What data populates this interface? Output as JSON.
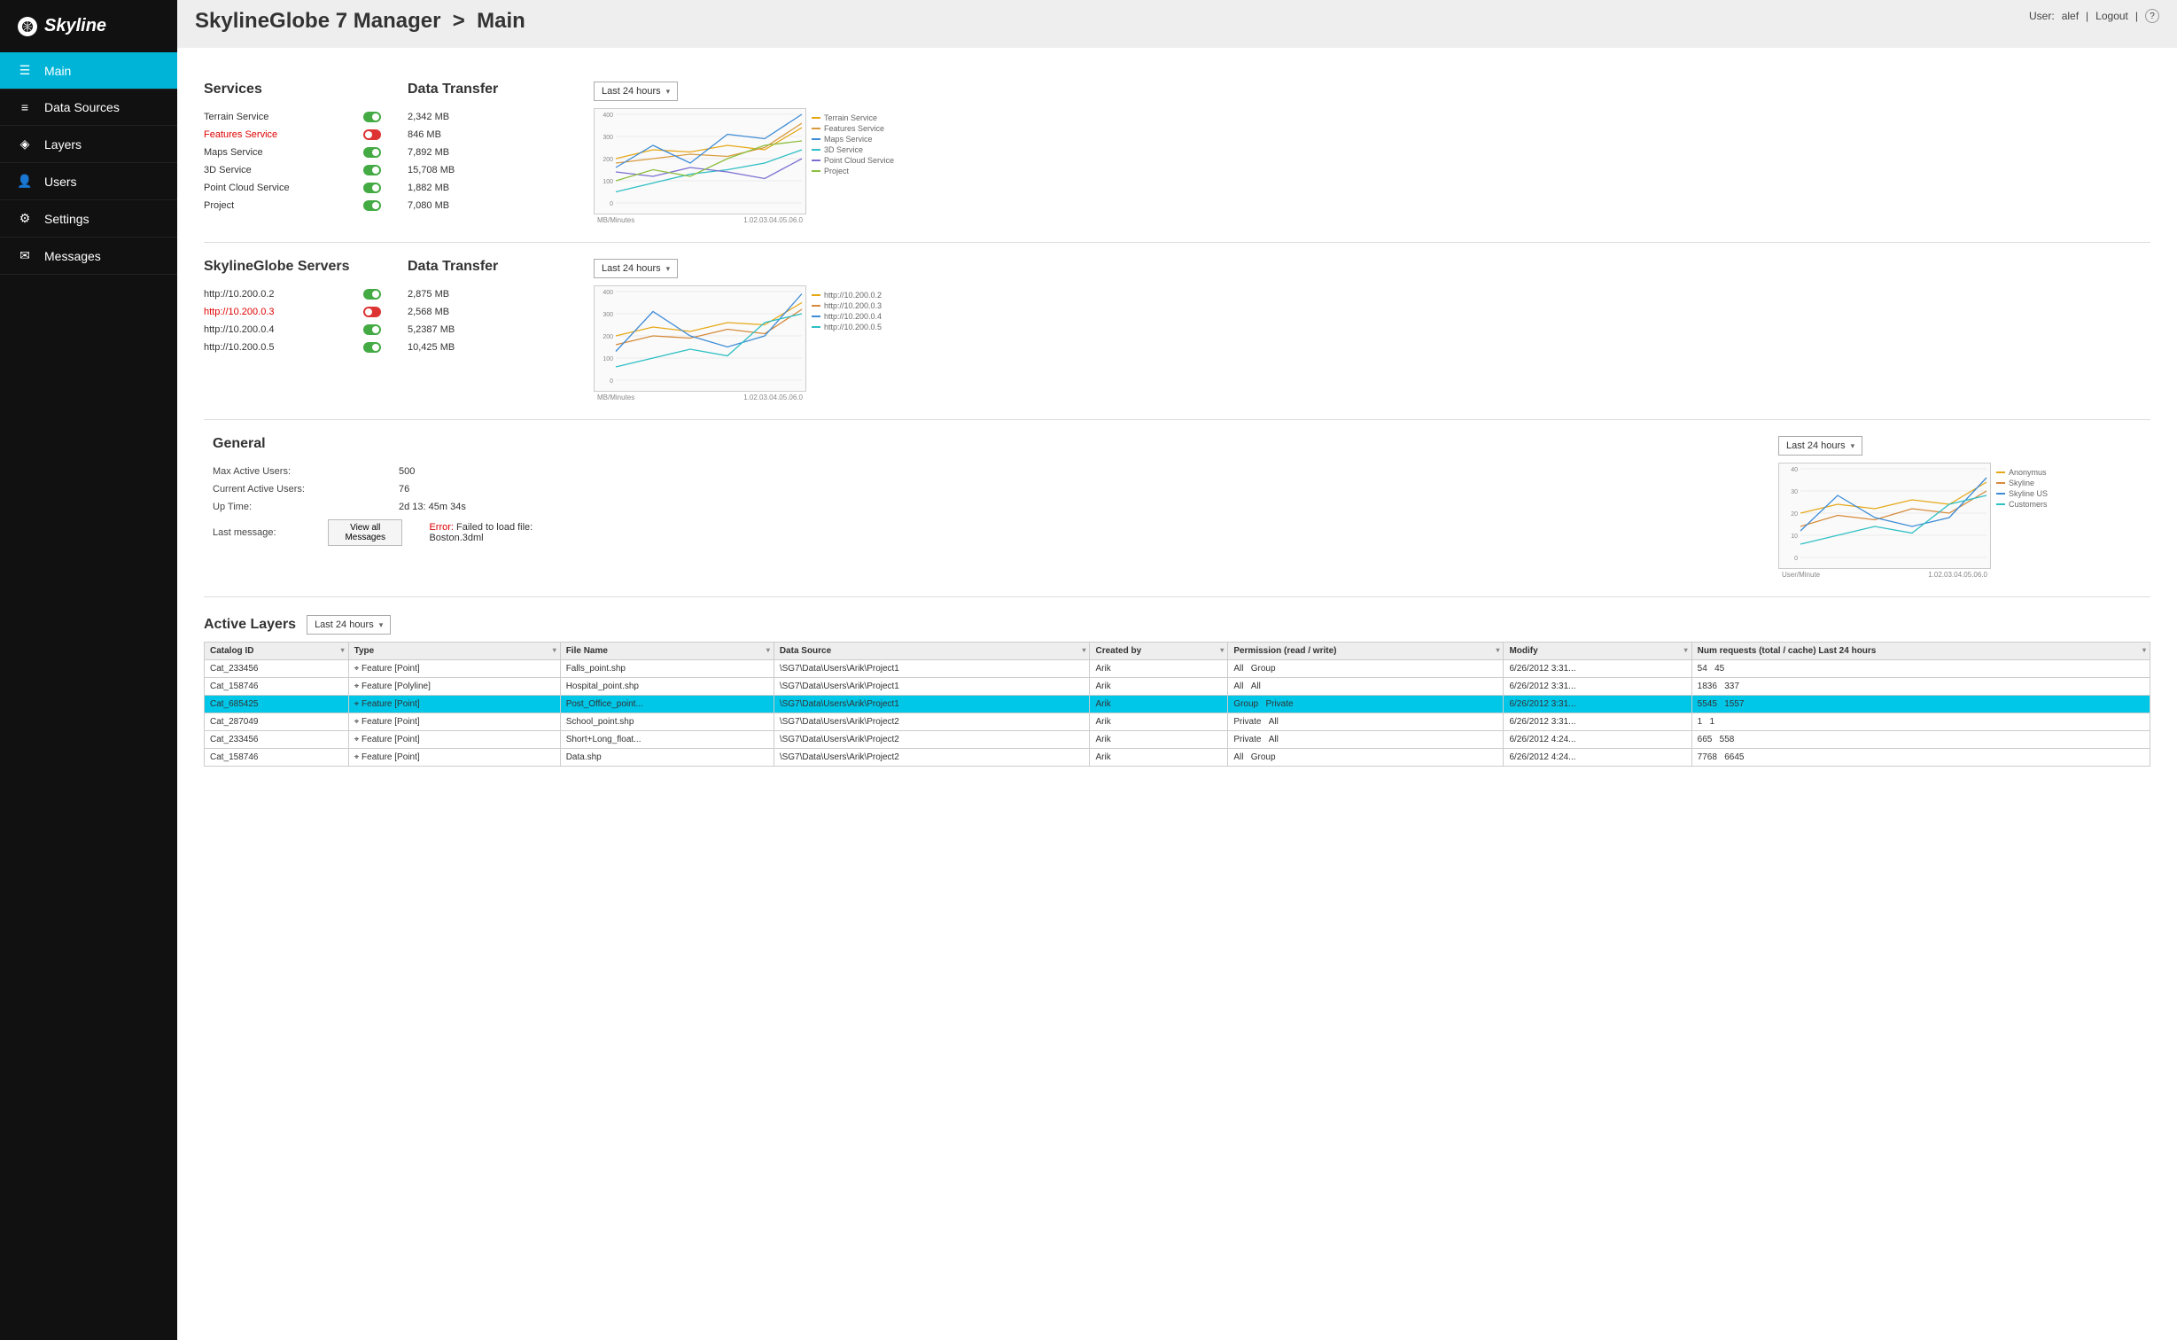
{
  "brand": "Skyline",
  "header": {
    "app": "SkylineGlobe 7 Manager",
    "sep": ">",
    "page": "Main",
    "user_label": "User:",
    "user": "alef",
    "logout": "Logout",
    "help": "?"
  },
  "nav": [
    {
      "label": "Main",
      "icon": "menu",
      "active": true
    },
    {
      "label": "Data Sources",
      "icon": "db",
      "active": false
    },
    {
      "label": "Layers",
      "icon": "layers",
      "active": false
    },
    {
      "label": "Users",
      "icon": "user",
      "active": false
    },
    {
      "label": "Settings",
      "icon": "gear",
      "active": false
    },
    {
      "label": "Messages",
      "icon": "mail",
      "active": false
    }
  ],
  "services": {
    "title": "Services",
    "transfer_title": "Data Transfer",
    "dropdown": "Last 24 hours",
    "items": [
      {
        "name": "Terrain Service",
        "on": true,
        "transfer": "2,342 MB"
      },
      {
        "name": "Features Service",
        "on": false,
        "transfer": "846 MB"
      },
      {
        "name": "Maps Service",
        "on": true,
        "transfer": "7,892 MB"
      },
      {
        "name": "3D Service",
        "on": true,
        "transfer": "15,708 MB"
      },
      {
        "name": "Point Cloud Service",
        "on": true,
        "transfer": "1,882 MB"
      },
      {
        "name": "Project",
        "on": true,
        "transfer": "7,080 MB"
      }
    ],
    "chart_ylabel": "MB/Minutes",
    "legend": [
      "Terrain Service",
      "Features Service",
      "Maps Service",
      "3D Service",
      "Point Cloud Service",
      "Project"
    ]
  },
  "servers": {
    "title": "SkylineGlobe Servers",
    "transfer_title": "Data Transfer",
    "dropdown": "Last 24 hours",
    "items": [
      {
        "name": "http://10.200.0.2",
        "on": true,
        "transfer": "2,875 MB"
      },
      {
        "name": "http://10.200.0.3",
        "on": false,
        "transfer": "2,568 MB"
      },
      {
        "name": "http://10.200.0.4",
        "on": true,
        "transfer": "5,2387 MB"
      },
      {
        "name": "http://10.200.0.5",
        "on": true,
        "transfer": "10,425 MB"
      }
    ],
    "chart_ylabel": "MB/Minutes",
    "legend": [
      "http://10.200.0.2",
      "http://10.200.0.3",
      "http://10.200.0.4",
      "http://10.200.0.5"
    ]
  },
  "general": {
    "title": "General",
    "dropdown": "Last 24 hours",
    "rows": {
      "max_active_users_label": "Max Active Users:",
      "max_active_users": "500",
      "current_active_users_label": "Current Active Users:",
      "current_active_users": "76",
      "uptime_label": "Up Time:",
      "uptime": "2d 13: 45m 34s",
      "last_message_label": "Last message:",
      "view_all": "View all Messages",
      "error_prefix": "Error:",
      "error_text": "Failed to load file: Boston.3dml"
    },
    "chart_ylabel": "User/Minute",
    "legend": [
      "Anonymus",
      "Skyline",
      "Skyline US",
      "Customers"
    ]
  },
  "active_layers": {
    "title": "Active Layers",
    "dropdown": "Last 24 hours",
    "columns": [
      "Catalog ID",
      "Type",
      "File Name",
      "Data Source",
      "Created by",
      "Permission (read / write)",
      "Modify",
      "Num requests (total / cache) Last 24 hours"
    ],
    "rows": [
      {
        "id": "Cat_233456",
        "type": "Feature  [Point]",
        "file": "Falls_point.shp",
        "ds": "\\SG7\\Data\\Users\\Arik\\Project1",
        "by": "Arik",
        "perm_r": "All",
        "perm_w": "Group",
        "mod": "6/26/2012 3:31...",
        "req_t": "54",
        "req_c": "45",
        "sel": false
      },
      {
        "id": "Cat_158746",
        "type": "Feature  [Polyline]",
        "file": "Hospital_point.shp",
        "ds": "\\SG7\\Data\\Users\\Arik\\Project1",
        "by": "Arik",
        "perm_r": "All",
        "perm_w": "All",
        "mod": "6/26/2012 3:31...",
        "req_t": "1836",
        "req_c": "337",
        "sel": false
      },
      {
        "id": "Cat_685425",
        "type": "Feature  [Point]",
        "file": "Post_Office_point...",
        "ds": "\\SG7\\Data\\Users\\Arik\\Project1",
        "by": "Arik",
        "perm_r": "Group",
        "perm_w": "Private",
        "mod": "6/26/2012 3:31...",
        "req_t": "5545",
        "req_c": "1557",
        "sel": true
      },
      {
        "id": "Cat_287049",
        "type": "Feature  [Point]",
        "file": "School_point.shp",
        "ds": "\\SG7\\Data\\Users\\Arik\\Project2",
        "by": "Arik",
        "perm_r": "Private",
        "perm_w": "All",
        "mod": "6/26/2012 3:31...",
        "req_t": "1",
        "req_c": "1",
        "sel": false
      },
      {
        "id": "Cat_233456",
        "type": "Feature  [Point]",
        "file": "Short+Long_float...",
        "ds": "\\SG7\\Data\\Users\\Arik\\Project2",
        "by": "Arik",
        "perm_r": "Private",
        "perm_w": "All",
        "mod": "6/26/2012 4:24...",
        "req_t": "665",
        "req_c": "558",
        "sel": false
      },
      {
        "id": "Cat_158746",
        "type": "Feature  [Point]",
        "file": "Data.shp",
        "ds": "\\SG7\\Data\\Users\\Arik\\Project2",
        "by": "Arik",
        "perm_r": "All",
        "perm_w": "Group",
        "mod": "6/26/2012 4:24...",
        "req_t": "7768",
        "req_c": "6645",
        "sel": false
      }
    ]
  },
  "chart_data": [
    {
      "type": "line",
      "title": "Services Data Transfer",
      "xlabel": "MB/Minutes",
      "ylabel": "",
      "x": [
        1.0,
        2.0,
        3.0,
        4.0,
        5.0,
        6.0
      ],
      "ylim": [
        0,
        400
      ],
      "series": [
        {
          "name": "Terrain Service",
          "color": "#e6a817",
          "values": [
            200,
            240,
            230,
            260,
            240,
            340
          ]
        },
        {
          "name": "Features Service",
          "color": "#d99a3f",
          "values": [
            180,
            200,
            220,
            210,
            250,
            360
          ]
        },
        {
          "name": "Maps Service",
          "color": "#3d8bd6",
          "values": [
            160,
            260,
            180,
            310,
            290,
            400
          ]
        },
        {
          "name": "3D Service",
          "color": "#2fbfc4",
          "values": [
            50,
            90,
            130,
            150,
            180,
            240
          ]
        },
        {
          "name": "Point Cloud Service",
          "color": "#7a6fd1",
          "values": [
            140,
            120,
            160,
            140,
            110,
            200
          ]
        },
        {
          "name": "Project",
          "color": "#8bbf3d",
          "values": [
            100,
            150,
            120,
            200,
            260,
            280
          ]
        }
      ]
    },
    {
      "type": "line",
      "title": "Servers Data Transfer",
      "xlabel": "MB/Minutes",
      "ylabel": "",
      "x": [
        1.0,
        2.0,
        3.0,
        4.0,
        5.0,
        6.0
      ],
      "ylim": [
        0,
        400
      ],
      "series": [
        {
          "name": "http://10.200.0.2",
          "color": "#e6a817",
          "values": [
            200,
            240,
            220,
            260,
            250,
            350
          ]
        },
        {
          "name": "http://10.200.0.3",
          "color": "#d68a3a",
          "values": [
            160,
            200,
            190,
            230,
            210,
            320
          ]
        },
        {
          "name": "http://10.200.0.4",
          "color": "#3d8bd6",
          "values": [
            130,
            310,
            200,
            150,
            200,
            390
          ]
        },
        {
          "name": "http://10.200.0.5",
          "color": "#2fbfc4",
          "values": [
            60,
            100,
            140,
            110,
            260,
            300
          ]
        }
      ]
    },
    {
      "type": "line",
      "title": "General Users",
      "xlabel": "User/Minute",
      "ylabel": "",
      "x": [
        1.0,
        2.0,
        3.0,
        4.0,
        5.0,
        6.0
      ],
      "ylim": [
        0,
        40
      ],
      "series": [
        {
          "name": "Anonymus",
          "color": "#e6a817",
          "values": [
            20,
            24,
            22,
            26,
            24,
            34
          ]
        },
        {
          "name": "Skyline",
          "color": "#d68a3a",
          "values": [
            14,
            19,
            17,
            22,
            20,
            30
          ]
        },
        {
          "name": "Skyline US",
          "color": "#3d8bd6",
          "values": [
            12,
            28,
            18,
            14,
            18,
            36
          ]
        },
        {
          "name": "Customers",
          "color": "#2fbfc4",
          "values": [
            6,
            10,
            14,
            11,
            24,
            28
          ]
        }
      ]
    }
  ],
  "chart_xticks": [
    "1.0",
    "2.0",
    "3.0",
    "4.0",
    "5.0",
    "6.0"
  ]
}
